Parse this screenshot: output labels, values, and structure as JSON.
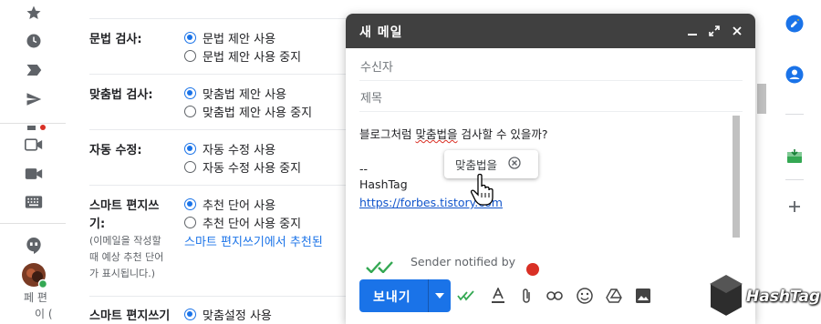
{
  "rail": {
    "icons": [
      "star-icon",
      "clock-icon",
      "label-icon",
      "send-icon",
      "video-icon",
      "camera-icon",
      "keyboard-icon",
      "hangouts-icon",
      "avatar"
    ],
    "fragment_1": "페 편",
    "fragment_2": "이 ("
  },
  "settings": {
    "grammar": {
      "label": "문법 검사:",
      "on": "문법 제안 사용",
      "off": "문법 제안 사용 중지"
    },
    "spelling": {
      "label": "맞춤법 검사:",
      "on": "맞춤법 제안 사용",
      "off": "맞춤법 제안 사용 중지"
    },
    "autocorrect": {
      "label": "자동 수정:",
      "on": "자동 수정 사용",
      "off": "자동 수정 사용 중지"
    },
    "smart_compose": {
      "label_line1": "스마트 편지쓰",
      "label_line2": "기:",
      "note_line1": "(이메일을 작성할",
      "note_line2": "때 예상 추천 단어",
      "note_line3": "가 표시됩니다.)",
      "on": "추천 단어 사용",
      "off": "추천 단어 사용 중지",
      "link": "스마트 편지쓰기에서 추천된"
    },
    "smart_compose_personal": {
      "label": "스마트 편지쓰기",
      "on": "맞춤설정 사용"
    }
  },
  "compose": {
    "title": "새 메일",
    "to_label": "수신자",
    "subject_label": "제목",
    "body": {
      "line_before": "블로그처럼 ",
      "misspelled": "맞춤법을",
      "line_after": " 검사할 수 있을까?",
      "sig_dash": "--",
      "sig_name": "HashTag",
      "sig_link": "https://forbes.tistory.com"
    },
    "spell_popup": "맞춤법을",
    "sender_note": "Sender notified by",
    "send_label": "보내기",
    "tools": [
      "formatting-icon",
      "attach-icon",
      "link-icon",
      "emoji-icon",
      "drive-icon",
      "photo-icon"
    ]
  },
  "side_panel": {
    "icons": [
      "tasks-icon",
      "contacts-icon",
      "addon-icon",
      "add-icon"
    ]
  },
  "watermark": "HashTag",
  "colors": {
    "accent": "#1a73e8",
    "header": "#404040",
    "spell_error": "#d93025",
    "green": "#34a853"
  }
}
